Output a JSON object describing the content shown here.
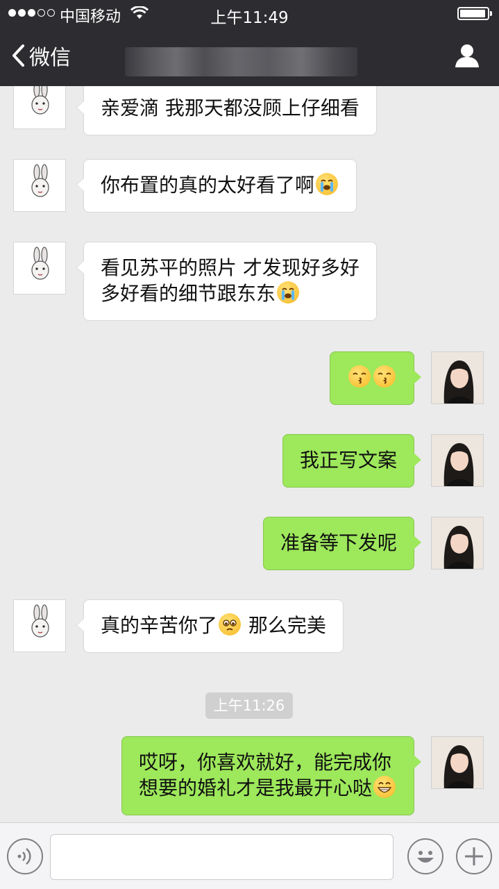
{
  "status_bar": {
    "carrier": "中国移动",
    "time": "上午11:49"
  },
  "nav": {
    "back_label": "微信"
  },
  "messages": [
    {
      "side": "in",
      "text": "亲爱滴 我那天都没顾上仔细看",
      "emoji": ""
    },
    {
      "side": "in",
      "text": "你布置的真的太好看了啊",
      "emoji": "loudly-crying-face"
    },
    {
      "side": "in",
      "lines": [
        "看见苏平的照片 才发现好多好",
        "多好看的细节跟东东"
      ],
      "emoji": "loudly-crying-face"
    },
    {
      "side": "out",
      "emoji": "kissing-face x2"
    },
    {
      "side": "out",
      "text": "我正写文案"
    },
    {
      "side": "out",
      "text": "准备等下发呢"
    },
    {
      "side": "in",
      "text_before": "真的辛苦你了",
      "text_after": " 那么完美",
      "emoji": "pleading-face"
    },
    {
      "side": "out",
      "lines": [
        "哎呀，你喜欢就好，能完成你",
        "想要的婚礼才是我最开心哒"
      ],
      "emoji": "grinning-face"
    }
  ],
  "timestamp": "上午11:26",
  "colors": {
    "nav_bg": "#2d2d31",
    "chat_bg": "#ebebeb",
    "outgoing_bubble": "#9de85b",
    "incoming_bubble": "#ffffff"
  }
}
